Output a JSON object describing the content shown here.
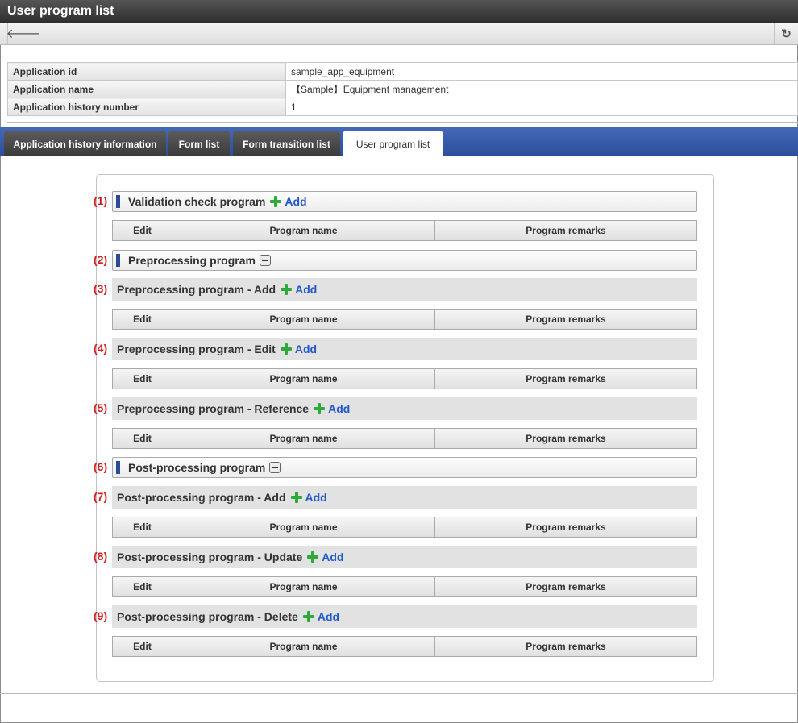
{
  "window": {
    "title": "User program list"
  },
  "toolbar": {
    "back_icon": "arrow-left-icon",
    "reload_icon": "reload-icon"
  },
  "info": {
    "rows": [
      {
        "label": "Application id",
        "value": "sample_app_equipment"
      },
      {
        "label": "Application name",
        "value": "【Sample】Equipment management"
      },
      {
        "label": "Application history number",
        "value": "1"
      }
    ]
  },
  "tabs": [
    {
      "label": "Application history information",
      "active": false
    },
    {
      "label": "Form list",
      "active": false
    },
    {
      "label": "Form transition list",
      "active": false
    },
    {
      "label": "User program list",
      "active": true
    }
  ],
  "table_headers": {
    "edit": "Edit",
    "program_name": "Program name",
    "program_remarks": "Program remarks"
  },
  "sections": [
    {
      "num": "(1)",
      "title": "Validation check program",
      "add": "Add"
    },
    {
      "num": "(2)",
      "title": "Preprocessing program"
    },
    {
      "num": "(3)",
      "title": "Preprocessing program - Add",
      "add": "Add"
    },
    {
      "num": "(4)",
      "title": "Preprocessing program - Edit",
      "add": "Add"
    },
    {
      "num": "(5)",
      "title": "Preprocessing program - Reference",
      "add": "Add"
    },
    {
      "num": "(6)",
      "title": "Post-processing program"
    },
    {
      "num": "(7)",
      "title": "Post-processing program - Add",
      "add": "Add"
    },
    {
      "num": "(8)",
      "title": "Post-processing program - Update",
      "add": "Add"
    },
    {
      "num": "(9)",
      "title": "Post-processing program - Delete",
      "add": "Add"
    }
  ],
  "colors": {
    "accent": "#2b4c94",
    "tabbar": "#2f53a3",
    "annotation": "#d02020",
    "add_link": "#2259c9",
    "add_icon": "#2eaa3a"
  }
}
